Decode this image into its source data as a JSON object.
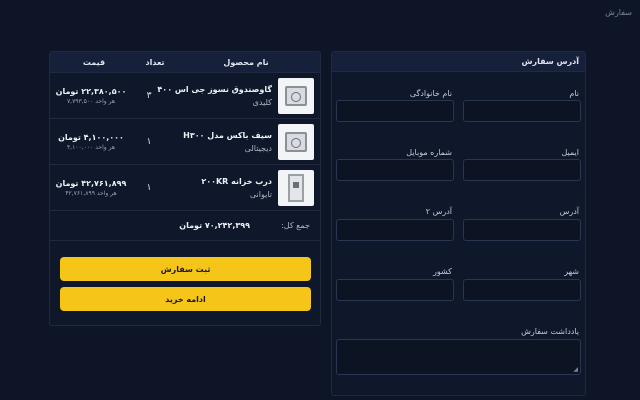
{
  "page_tag": "سفارش",
  "cart": {
    "headers": {
      "name": "نام محصول",
      "qty": "تعداد",
      "price": "قیمت"
    },
    "items": [
      {
        "name": "گاوصندوق نسوز جی اس ۴۰۰",
        "category": "کلیدی",
        "qty": "۳",
        "total": "۲۲,۳۸۰,۵۰۰ تومان",
        "unit": "هر واحد ۷,۷۹۳,۵۰۰",
        "icon": "safe-image"
      },
      {
        "name": "سیف باکس مدل H۳۰۰",
        "category": "دیجیتالی",
        "qty": "۱",
        "total": "۴,۱۰۰,۰۰۰ تومان",
        "unit": "هر واحد ۴,۱۰۰,۰۰۰",
        "icon": "safebox-image"
      },
      {
        "name": "درب خزانه ۲۰۰KR",
        "category": "تایوانی",
        "qty": "۱",
        "total": "۴۲,۷۶۱,۸۹۹ تومان",
        "unit": "هر واحد ۴۲,۷۶۱,۸۹۹",
        "icon": "vault-door-image"
      }
    ],
    "sum_label": "جمع کل:",
    "sum_value": "۷۰,۲۴۲,۳۹۹ تومان",
    "submit_label": "ثبت سفارش",
    "continue_label": "ادامه خرید"
  },
  "form": {
    "title": "آدرس سفارش",
    "first_name": "نام",
    "last_name": "نام خانوادگی",
    "email": "ایمیل",
    "mobile": "شماره موبایل",
    "address": "آدرس",
    "address2": "آدرس ۲",
    "city": "شهر",
    "country": "کشور",
    "note": "یادداشت سفارش"
  },
  "colors": {
    "background": "#0d1526",
    "accent": "#f5c518"
  }
}
